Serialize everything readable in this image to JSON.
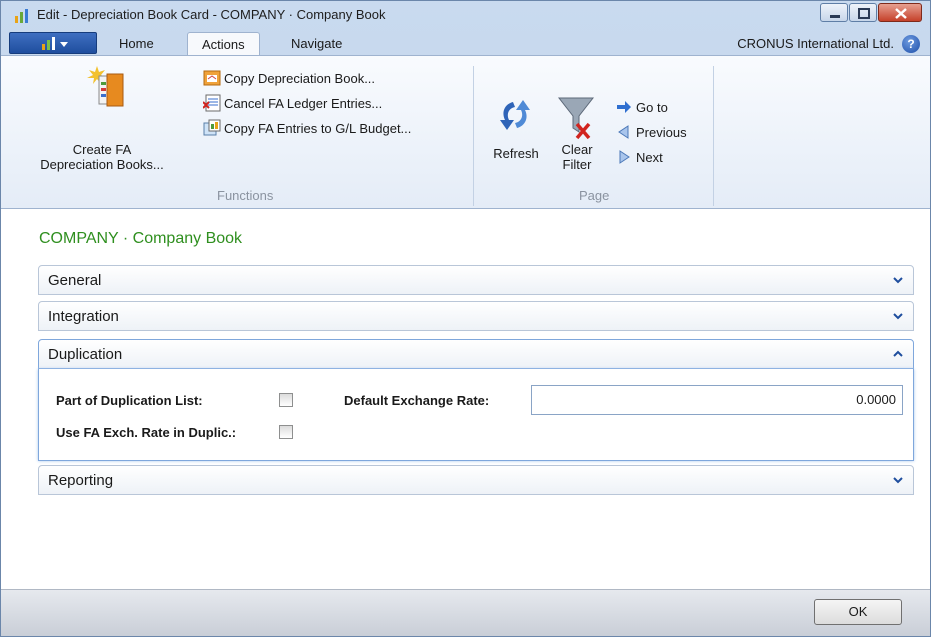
{
  "window": {
    "title": "Edit - Depreciation Book Card - COMPANY · Company Book"
  },
  "tabs": [
    {
      "label": "Home"
    },
    {
      "label": "Actions"
    },
    {
      "label": "Navigate"
    }
  ],
  "company": "CRONUS International Ltd.",
  "ribbon": {
    "functions_group": {
      "label": "Functions",
      "create_fa_line1": "Create FA",
      "create_fa_line2": "Depreciation Books...",
      "actions": [
        {
          "label": "Copy Depreciation Book..."
        },
        {
          "label": "Cancel FA Ledger Entries..."
        },
        {
          "label": "Copy FA Entries to G/L Budget..."
        }
      ]
    },
    "page_group": {
      "label": "Page",
      "refresh": "Refresh",
      "clear_line1": "Clear",
      "clear_line2": "Filter",
      "nav": [
        {
          "label": "Go to"
        },
        {
          "label": "Previous"
        },
        {
          "label": "Next"
        }
      ]
    }
  },
  "page_title": "COMPANY · Company Book",
  "fasttabs": [
    {
      "label": "General",
      "expanded": false
    },
    {
      "label": "Integration",
      "expanded": false
    },
    {
      "label": "Duplication",
      "expanded": true
    },
    {
      "label": "Reporting",
      "expanded": false
    }
  ],
  "duplication": {
    "part_of_list_label": "Part of Duplication List:",
    "part_of_list_checked": false,
    "use_fa_exch_label": "Use FA Exch. Rate in Duplic.:",
    "use_fa_exch_checked": false,
    "default_exch_label": "Default Exchange Rate:",
    "default_exch_value": "0.0000"
  },
  "footer": {
    "ok": "OK"
  },
  "colors": {
    "title_green": "#2f8f1f",
    "accent_blue": "#1f4e9e"
  }
}
